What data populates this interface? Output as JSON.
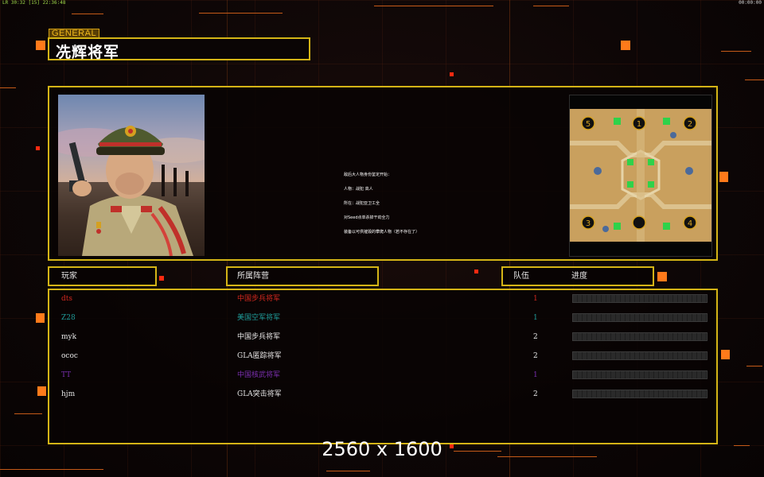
{
  "statusbar": {
    "left": "LR 30:32 [15] 22:36:48",
    "right": "00:00:00"
  },
  "header": {
    "tag": "GENERAL",
    "title": "冼辉将军"
  },
  "briefing": {
    "lines": [
      "敌后大人物身份鉴定开始：",
      "人物：战犯 高人",
      "所在：战犯亚卫工全",
      "对Seed点单杀掉干劲全力",
      "装备以可供摧毁的攀爬人物（若不存在了）"
    ]
  },
  "minimap": {
    "start_positions": [
      "5",
      "1",
      "2",
      "3",
      "4"
    ]
  },
  "table": {
    "headers": {
      "player": "玩家",
      "faction": "所属阵营",
      "team": "队伍",
      "progress": "进度"
    },
    "rows": [
      {
        "name": "dts",
        "faction": "中国步兵将军",
        "team": "1",
        "color": "#d2281e",
        "progress": 0
      },
      {
        "name": "Z28",
        "faction": "美国空军将军",
        "team": "1",
        "color": "#1f9c9a",
        "progress": 0
      },
      {
        "name": "myk",
        "faction": "中国步兵将军",
        "team": "2",
        "color": "#e6e6e6",
        "progress": 0
      },
      {
        "name": "ococ",
        "faction": "GLA匿踪将军",
        "team": "2",
        "color": "#e6e6e6",
        "progress": 0
      },
      {
        "name": "TT",
        "faction": "中国核武将军",
        "team": "1",
        "color": "#7a2fb0",
        "progress": 0
      },
      {
        "name": "hjm",
        "faction": "GLA突击将军",
        "team": "2",
        "color": "#e6e6e6",
        "progress": 0
      }
    ]
  },
  "overlay": {
    "resolution": "2560 x 1600"
  },
  "colors": {
    "frame": "#d4b416",
    "accent_orange": "#ff7a1a",
    "progress_bar": "#2a2a2a"
  }
}
